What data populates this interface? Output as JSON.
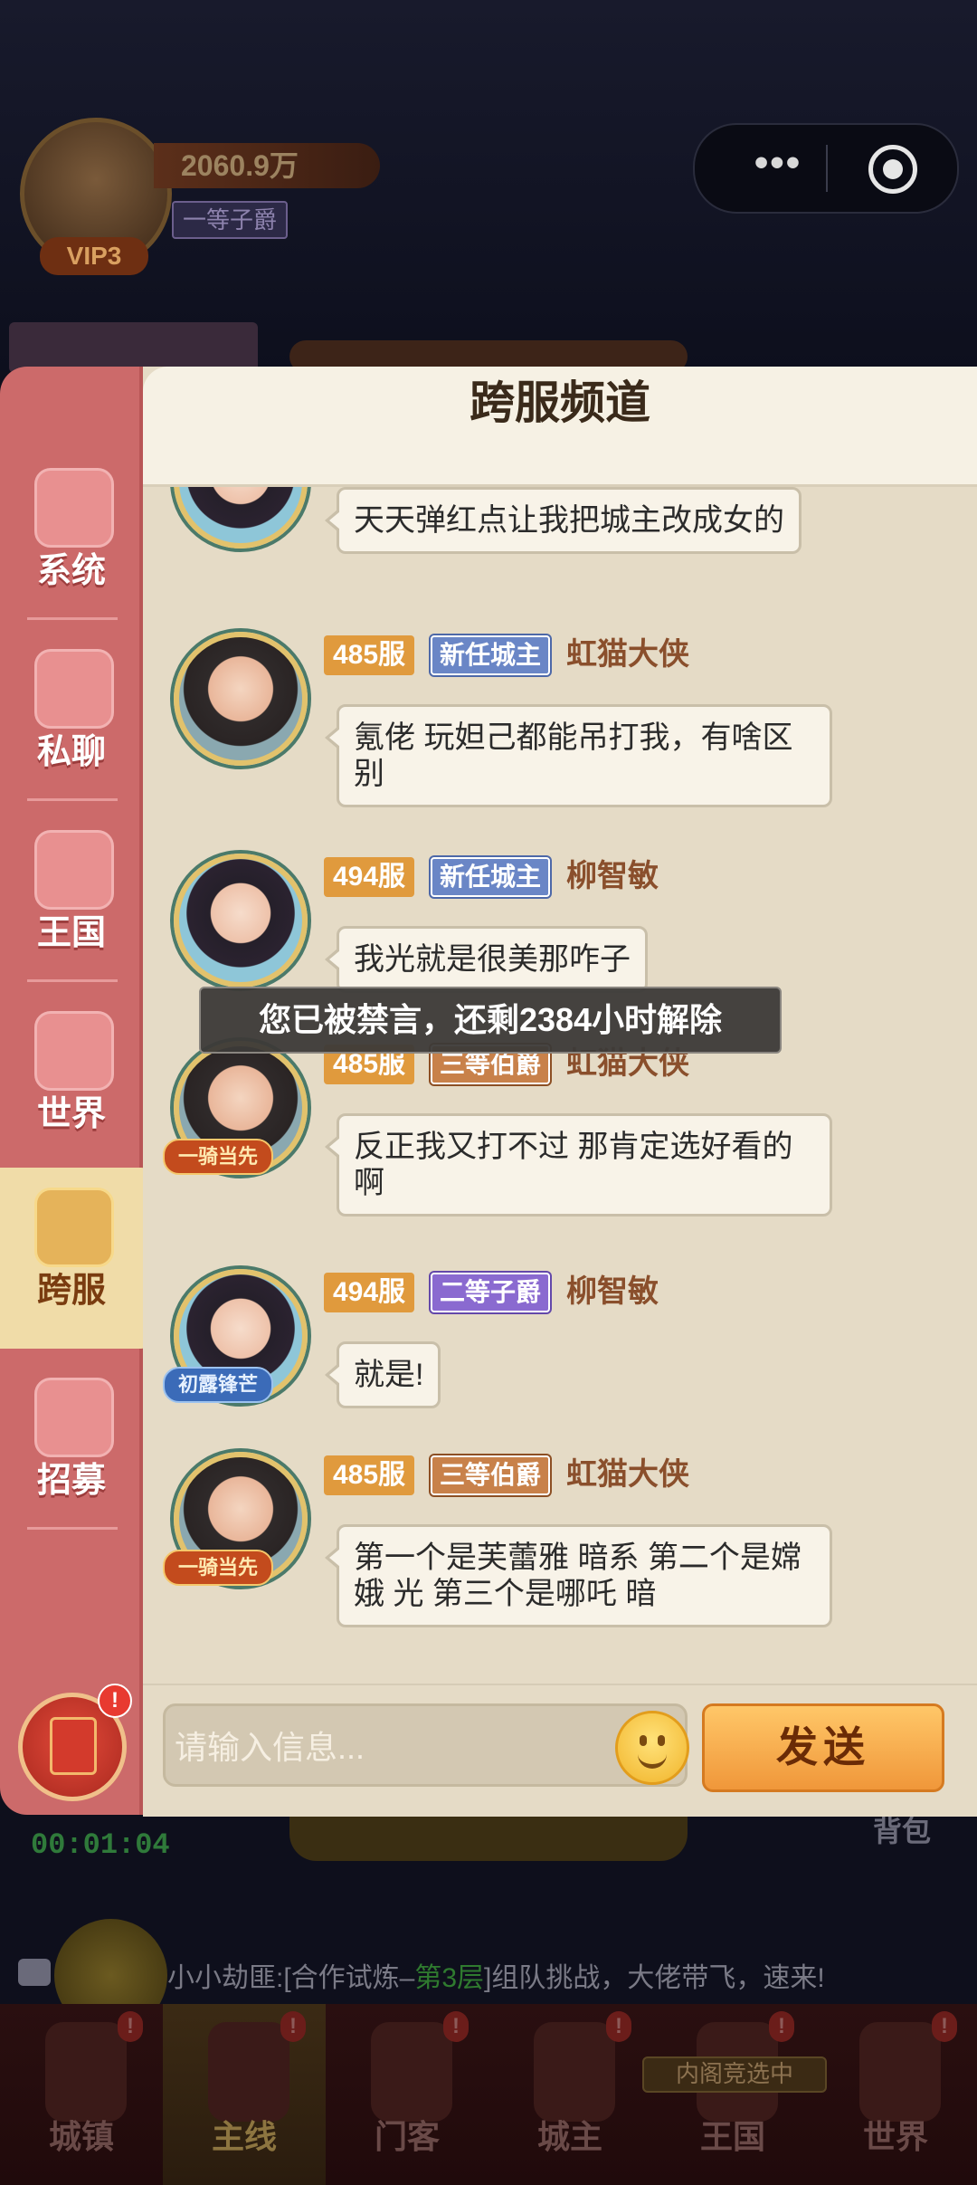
{
  "top": {
    "vip": "VIP3",
    "power": "2060.9万",
    "rank": "一等子爵"
  },
  "panel": {
    "title": "跨服频道"
  },
  "tabs": [
    {
      "label": "系统",
      "icon": "bell-icon",
      "active": false
    },
    {
      "label": "私聊",
      "icon": "chat-bubble-icon",
      "active": false
    },
    {
      "label": "王国",
      "icon": "kingdom-banner-icon",
      "active": false
    },
    {
      "label": "世界",
      "icon": "cloud-world-icon",
      "active": false
    },
    {
      "label": "跨服",
      "icon": "planet-icon",
      "active": true
    },
    {
      "label": "招募",
      "icon": "handshake-icon",
      "active": false
    }
  ],
  "messages": [
    {
      "text": "天天弹红点让我把城主改成女的"
    },
    {
      "server": "485服",
      "title": "新任城主",
      "title_style": "blue",
      "name": "虹猫大侠",
      "text": "氪佬 玩妲己都能吊打我，有啥区别",
      "avatar": "boy"
    },
    {
      "server": "494服",
      "title": "新任城主",
      "title_style": "blue",
      "name": "柳智敏",
      "text": "我光就是很美那咋子",
      "avatar": "girl"
    },
    {
      "server": "485服",
      "title": "三等伯爵",
      "title_style": "bronze",
      "name": "虹猫大侠",
      "text": "反正我又打不过 那肯定选好看的啊",
      "avatar": "boy",
      "avatar_tag": "一骑当先"
    },
    {
      "server": "494服",
      "title": "二等子爵",
      "title_style": "purple",
      "name": "柳智敏",
      "text": "就是!",
      "avatar": "girl",
      "avatar_tag": "初露锋芒"
    },
    {
      "server": "485服",
      "title": "三等伯爵",
      "title_style": "bronze",
      "name": "虹猫大侠",
      "text": "第一个是芙蕾雅 暗系 第二个是嫦娥 光 第三个是哪吒 暗",
      "avatar": "boy",
      "avatar_tag": "一骑当先"
    }
  ],
  "toast": "您已被禁言，还剩2384小时解除",
  "input": {
    "placeholder": "请输入信息...",
    "send_label": "发送"
  },
  "redbag_badge": "!",
  "background": {
    "timer": "00:01:04",
    "bag_label": "背包",
    "broadcast_prefix": "小小劫匪:[合作试炼–",
    "broadcast_highlight": "第3层",
    "broadcast_suffix": "]组队挑战，大佬带飞，速来!",
    "nav": [
      {
        "label": "城镇",
        "badge": "!"
      },
      {
        "label": "主线",
        "badge": "!",
        "active": true
      },
      {
        "label": "门客",
        "badge": "!"
      },
      {
        "label": "城主",
        "badge": "!"
      },
      {
        "label": "王国",
        "badge": "!",
        "tag": "内阁竞选中"
      },
      {
        "label": "世界",
        "badge": "!"
      }
    ]
  },
  "colors": {
    "rail": "#cc6a6a",
    "panel": "#e5dbc6",
    "server_badge": "#e09a3d",
    "send_button": "#f0973a"
  }
}
